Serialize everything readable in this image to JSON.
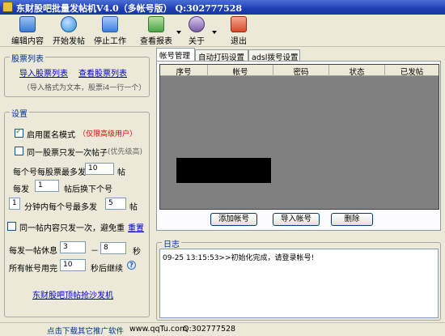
{
  "window": {
    "title": "东财股吧批量发帖机V4.0（多帐号版） Q:302777528"
  },
  "toolbar": {
    "items": [
      {
        "label": "编辑内容",
        "icon": "edit-icon",
        "color": "#3a7bd5"
      },
      {
        "label": "开始发帖",
        "icon": "play-icon",
        "color": "#2f8fd8"
      },
      {
        "label": "停止工作",
        "icon": "stop-icon",
        "color": "#3b7fe0"
      },
      {
        "label": "查看报表",
        "icon": "report-icon",
        "color": "#4aa34a"
      },
      {
        "label": "关于",
        "icon": "about-icon",
        "color": "#7b5aa6"
      },
      {
        "label": "退出",
        "icon": "power-icon",
        "color": "#d64a2a"
      }
    ]
  },
  "stock_list": {
    "title": "股票列表",
    "import_link": "导入股票列表",
    "view_link": "查看股票列表",
    "hint": "（导入格式为文本，股票i4一行一个）"
  },
  "settings": {
    "title": "设置",
    "anonymous": {
      "label": "启用匿名模式",
      "note": "（仅限高级用户）",
      "checked": true
    },
    "same_stock_once": {
      "label": "同一股票只发一次帖子",
      "note": "(优先级高)",
      "checked": false
    },
    "per_account_max_prefix": "每个号每股票最多发",
    "per_account_max_value": "10",
    "per_account_max_suffix": "帖",
    "switch_prefix": "每发",
    "switch_value": "1",
    "switch_suffix": "帖后换下个号",
    "minutes_value": "1",
    "minutes_mid": "分钟内每个号最多发",
    "minutes_max_value": "5",
    "minutes_suffix": "帖",
    "same_content_once": {
      "label": "同一帖内容只发一次，避免重",
      "link": "重置",
      "checked": false
    },
    "rest_prefix": "每发一帖休息",
    "rest_min": "3",
    "rest_dash": "－",
    "rest_max": "8",
    "rest_unit": "秒",
    "all_used_prefix": "所有帐号用完",
    "all_used_value": "10",
    "all_used_suffix": "秒后继续",
    "help_icon": "help-icon",
    "promo_link": "东财股吧顶帖抢沙发机"
  },
  "tabs": [
    "帐号管理",
    "自动打码设置",
    "adsl拨号设置"
  ],
  "accounts_table": {
    "columns": [
      "序号",
      "帐号",
      "密码",
      "状态",
      "已发帖"
    ]
  },
  "account_buttons": {
    "add": "添加帐号",
    "import": "导入帐号",
    "delete": "删除"
  },
  "log": {
    "title": "日志",
    "lines": [
      "09-25 13:15:53>>初始化完成，请登录帐号!"
    ]
  },
  "statusbar": {
    "download": "点击下载其它推广软件",
    "site": "www.qqTu.com",
    "contact": "Q:302777528"
  }
}
